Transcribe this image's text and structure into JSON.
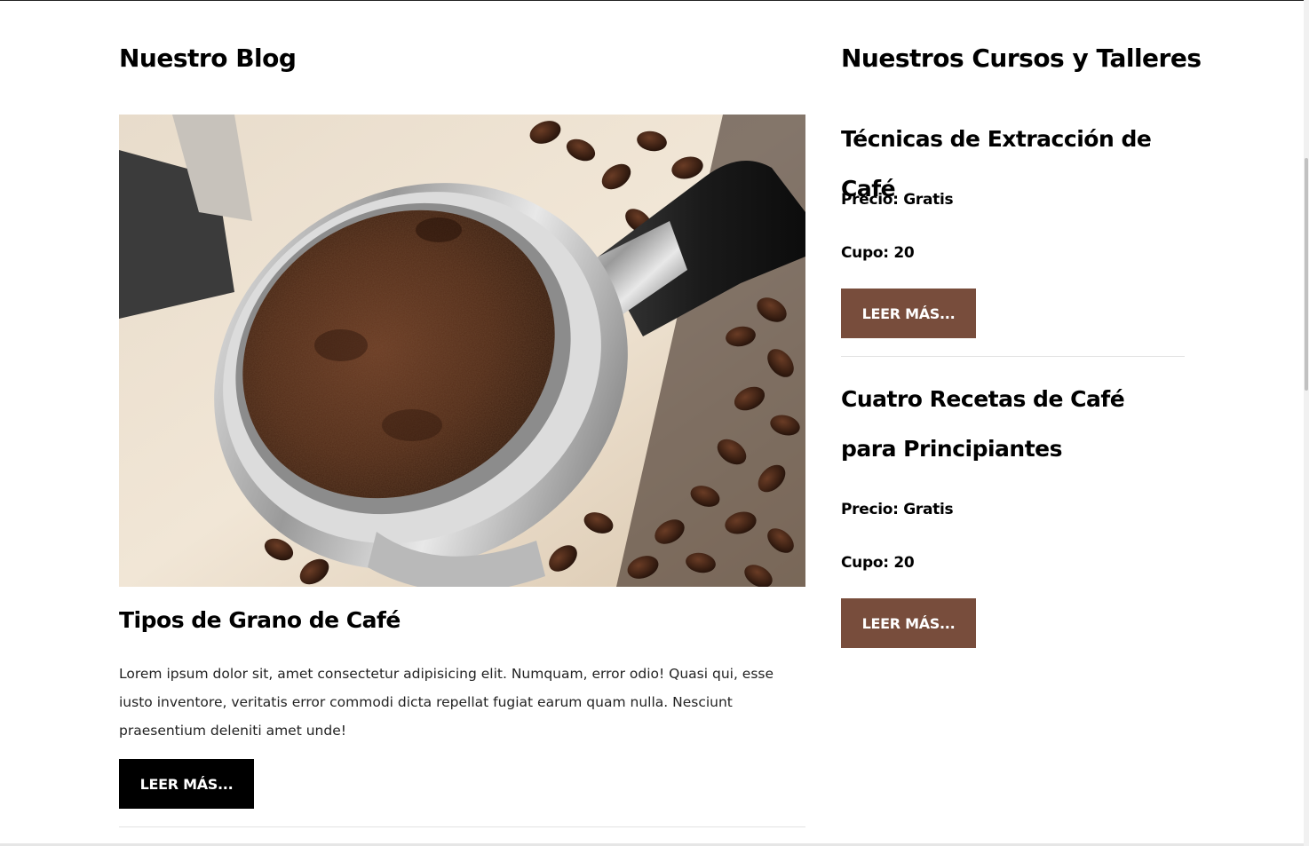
{
  "blog": {
    "heading": "Nuestro Blog",
    "post": {
      "image_alt": "Portafiltro con café molido y granos de café",
      "title": "Tipos de Grano de Café",
      "excerpt": "Lorem ipsum dolor sit, amet consectetur adipisicing elit. Numquam, error odio! Quasi qui, esse iusto inventore, veritatis error commodi dicta repellat fugiat earum quam nulla. Nesciunt praesentium deleniti amet unde!",
      "button_label": "LEER MÁS..."
    }
  },
  "courses": {
    "heading": "Nuestros Cursos y Talleres",
    "items": [
      {
        "title": "Técnicas de Extracción de Café",
        "price": "Precio: Gratis",
        "capacity": "Cupo: 20",
        "button_label": "LEER MÁS..."
      },
      {
        "title": "Cuatro Recetas de Café para Principiantes",
        "price": "Precio: Gratis",
        "capacity": "Cupo: 20",
        "button_label": "LEER MÁS..."
      }
    ]
  },
  "colors": {
    "course_button": "#784d3c",
    "blog_button": "#000000",
    "divider": "#e2e2e2"
  }
}
